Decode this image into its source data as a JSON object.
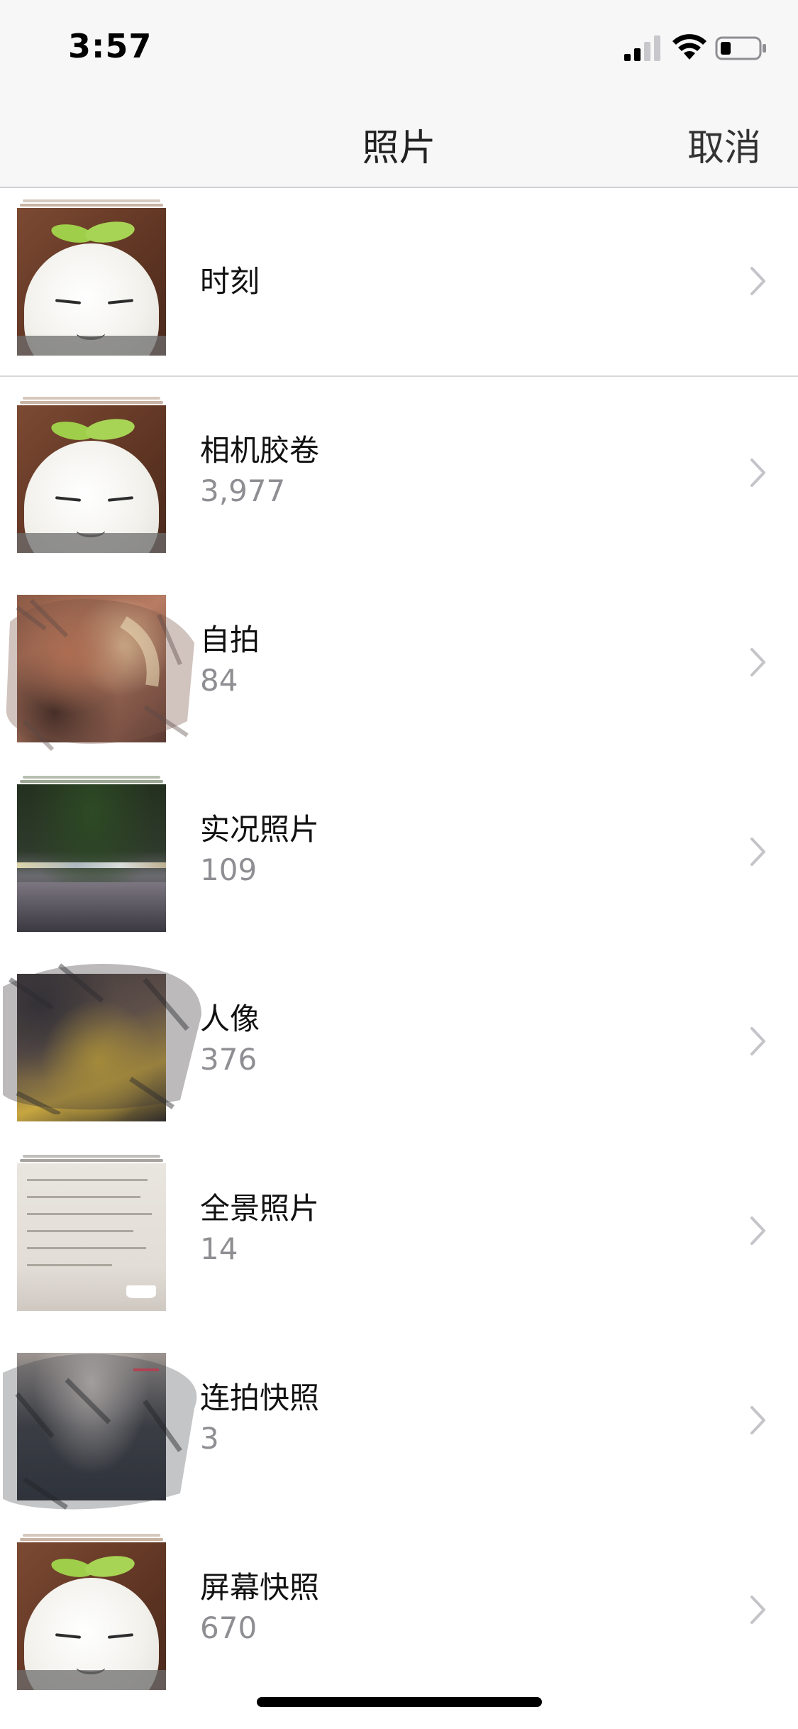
{
  "status_bar": {
    "time": "3:57",
    "icons": [
      "signal-icon",
      "wifi-icon",
      "battery-icon"
    ]
  },
  "nav": {
    "title": "照片",
    "cancel_label": "取消"
  },
  "moments": {
    "label": "时刻",
    "thumbnail": "plush-toy"
  },
  "albums": [
    {
      "name": "相机胶卷",
      "count": "3,977",
      "thumbnail": "plush-toy"
    },
    {
      "name": "自拍",
      "count": "84",
      "thumbnail": "selfie-blurred"
    },
    {
      "name": "实况照片",
      "count": "109",
      "thumbnail": "night-street"
    },
    {
      "name": "人像",
      "count": "376",
      "thumbnail": "portrait-blurred"
    },
    {
      "name": "全景照片",
      "count": "14",
      "thumbnail": "text-document"
    },
    {
      "name": "连拍快照",
      "count": "3",
      "thumbnail": "burst-blurred"
    },
    {
      "name": "屏幕快照",
      "count": "670",
      "thumbnail": "plush-toy"
    }
  ],
  "colors": {
    "bar_background": "#f7f7f7",
    "secondary_text": "#8e8e93",
    "separator": "#d8d8dc"
  }
}
